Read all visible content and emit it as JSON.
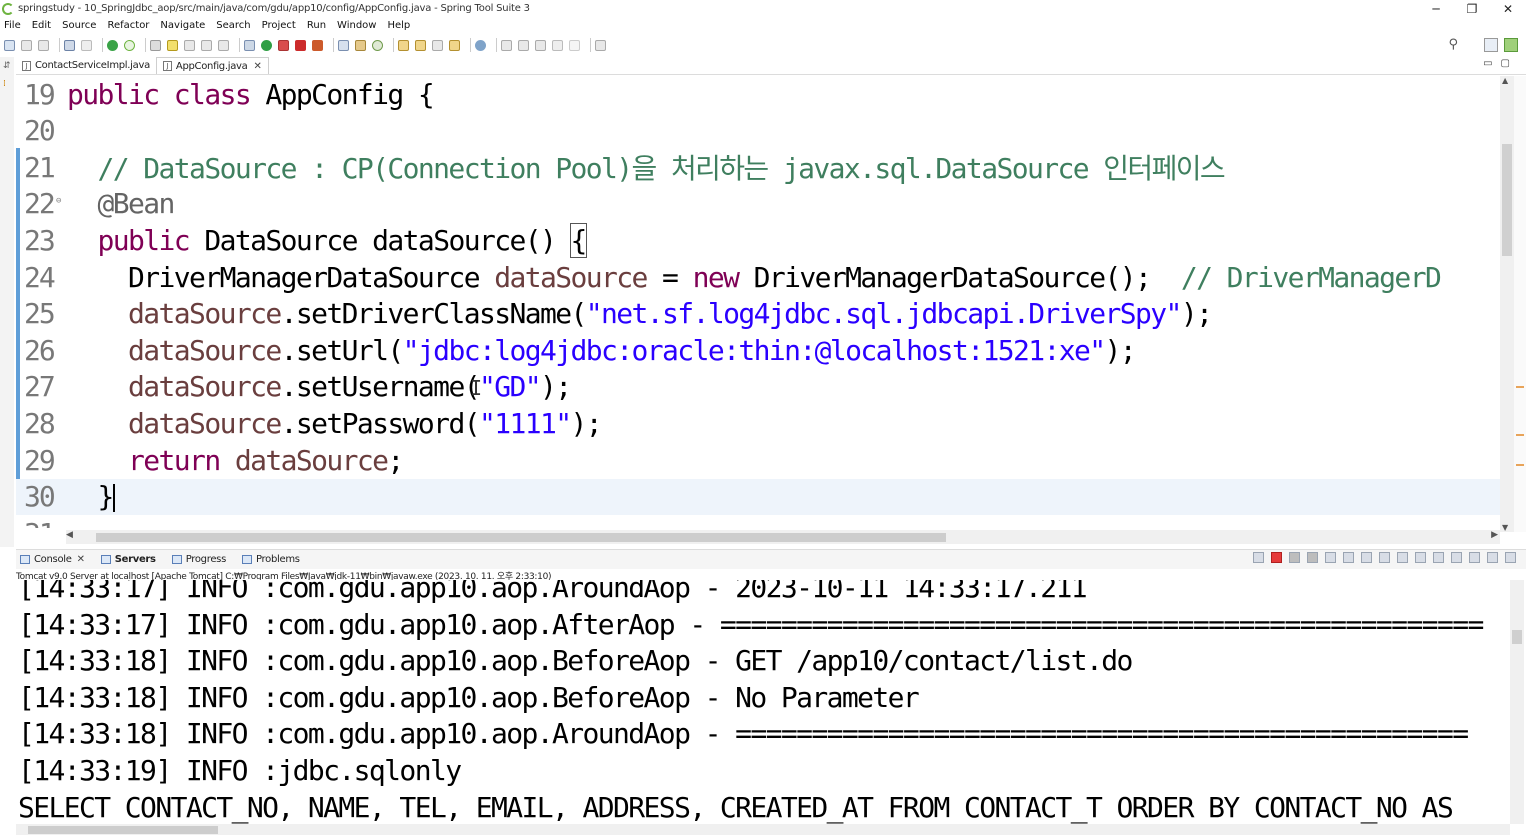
{
  "window": {
    "title": "springstudy - 10_SpringJdbc_aop/src/main/java/com/gdu/app10/config/AppConfig.java - Spring Tool Suite 3",
    "minimize": "─",
    "restore": "❐",
    "close": "✕"
  },
  "menu": [
    "File",
    "Edit",
    "Source",
    "Refactor",
    "Navigate",
    "Search",
    "Project",
    "Run",
    "Window",
    "Help"
  ],
  "editor_tabs": [
    {
      "label": "ContactServiceImpl.java",
      "active": false
    },
    {
      "label": "AppConfig.java",
      "active": true,
      "close": "✕"
    }
  ],
  "editor": {
    "lines": [
      {
        "num": "19",
        "tokens": [
          [
            "kw",
            "public class "
          ],
          [
            "plain",
            "AppConfig {"
          ]
        ]
      },
      {
        "num": "20",
        "tokens": []
      },
      {
        "num": "21",
        "tokens": [
          [
            "plain",
            "  "
          ],
          [
            "cm",
            "// DataSource : CP(Connection Pool)을 처리하는 javax.sql.DataSource 인터페이스"
          ]
        ]
      },
      {
        "num": "22",
        "fold": "⊖",
        "tokens": [
          [
            "plain",
            "  "
          ],
          [
            "ann",
            "@Bean"
          ]
        ]
      },
      {
        "num": "23",
        "tokens": [
          [
            "plain",
            "  "
          ],
          [
            "kw",
            "public "
          ],
          [
            "plain",
            "DataSource dataSource() "
          ],
          [
            "bracket",
            "{"
          ]
        ]
      },
      {
        "num": "24",
        "tokens": [
          [
            "plain",
            "    DriverManagerDataSource "
          ],
          [
            "var",
            "dataSource"
          ],
          [
            "plain",
            " = "
          ],
          [
            "kw",
            "new "
          ],
          [
            "plain",
            "DriverManagerDataSource();  "
          ],
          [
            "cm",
            "// DriverManagerD"
          ]
        ]
      },
      {
        "num": "25",
        "tokens": [
          [
            "plain",
            "    "
          ],
          [
            "var",
            "dataSource"
          ],
          [
            "plain",
            ".setDriverClassName("
          ],
          [
            "str",
            "\"net.sf.log4jdbc.sql.jdbcapi.DriverSpy\""
          ],
          [
            "plain",
            ");"
          ]
        ]
      },
      {
        "num": "26",
        "tokens": [
          [
            "plain",
            "    "
          ],
          [
            "var",
            "dataSource"
          ],
          [
            "plain",
            ".setUrl("
          ],
          [
            "str",
            "\"jdbc:log4jdbc:oracle:thin:@localhost:1521:xe\""
          ],
          [
            "plain",
            ");"
          ]
        ]
      },
      {
        "num": "27",
        "tokens": [
          [
            "plain",
            "    "
          ],
          [
            "var",
            "dataSource"
          ],
          [
            "plain",
            ".setUsername("
          ],
          [
            "str",
            "\"GD\""
          ],
          [
            "plain",
            ");"
          ]
        ]
      },
      {
        "num": "28",
        "tokens": [
          [
            "plain",
            "    "
          ],
          [
            "var",
            "dataSource"
          ],
          [
            "plain",
            ".setPassword("
          ],
          [
            "str",
            "\"1111\""
          ],
          [
            "plain",
            ");"
          ]
        ]
      },
      {
        "num": "29",
        "tokens": [
          [
            "plain",
            "    "
          ],
          [
            "kw",
            "return "
          ],
          [
            "var",
            "dataSource"
          ],
          [
            "plain",
            ";"
          ]
        ]
      },
      {
        "num": "30",
        "current": true,
        "tokens": [
          [
            "plain",
            "  }"
          ],
          [
            "caret",
            ""
          ]
        ]
      },
      {
        "num": "31",
        "tokens": []
      }
    ]
  },
  "console_tabs": [
    {
      "label": "Console",
      "close": "✕"
    },
    {
      "label": "Servers",
      "bold": true
    },
    {
      "label": "Progress"
    },
    {
      "label": "Problems"
    }
  ],
  "console_description": "Tomcat v9.0 Server at localhost [Apache Tomcat] C:₩Program Files₩Java₩jdk-11₩bin₩javaw.exe  (2023. 10. 11. 오후 2:33:10)",
  "console_lines": [
    "[14:33:17] INFO :com.gdu.app10.aop.AroundAop - 2023-10-11 14:33:17.211",
    "[14:33:17] INFO :com.gdu.app10.aop.AfterAop - ==================================================",
    "[14:33:18] INFO :com.gdu.app10.aop.BeforeAop - GET /app10/contact/list.do",
    "[14:33:18] INFO :com.gdu.app10.aop.BeforeAop - No Parameter",
    "[14:33:18] INFO :com.gdu.app10.aop.AroundAop - ================================================",
    "[14:33:19] INFO :jdbc.sqlonly",
    "SELECT CONTACT_NO, NAME, TEL, EMAIL, ADDRESS, CREATED_AT FROM CONTACT_T ORDER BY CONTACT_NO AS"
  ],
  "colors": {
    "keyword": "#7f0055",
    "comment": "#3f7f5f",
    "string": "#2a00ff",
    "variable": "#6a3e3e",
    "annotation": "#646464",
    "current_line": "#eef4fb"
  }
}
